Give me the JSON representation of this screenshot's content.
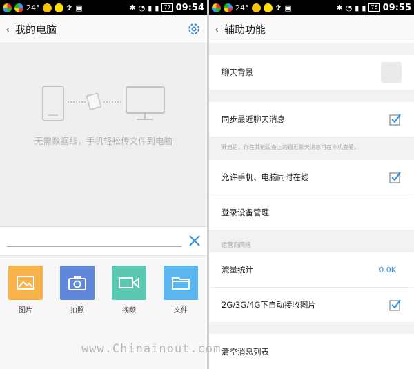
{
  "status_left": {
    "temp": "24°",
    "battery": "77",
    "time": "09:54"
  },
  "status_right": {
    "temp": "24°",
    "battery": "76",
    "time": "09:55"
  },
  "left": {
    "title": "我的电脑",
    "empty_text": "无需数据线，手机轻松传文件到电脑",
    "tiles": [
      {
        "label": "图片",
        "color": "#f7b24a",
        "icon": "image-icon"
      },
      {
        "label": "拍照",
        "color": "#5f87dc",
        "icon": "camera-icon"
      },
      {
        "label": "视频",
        "color": "#5bc8b1",
        "icon": "video-icon"
      },
      {
        "label": "文件",
        "color": "#5ab6ee",
        "icon": "folder-icon"
      }
    ]
  },
  "right": {
    "title": "辅助功能",
    "chat_bg": "聊天背景",
    "sync_recent": "同步最近聊天消息",
    "sync_note": "开启后，你在其他设备上的最近聊天消息可在本机查看。",
    "allow_online": "允许手机、电脑同时在线",
    "device_mgmt": "登录设备管理",
    "carrier_header": "运营商网络",
    "traffic": "流量统计",
    "traffic_value": "0.0K",
    "auto_image": "2G/3G/4G下自动接收图片",
    "clear_list": "清空消息列表",
    "watermark": "www.Chinainout.com"
  }
}
